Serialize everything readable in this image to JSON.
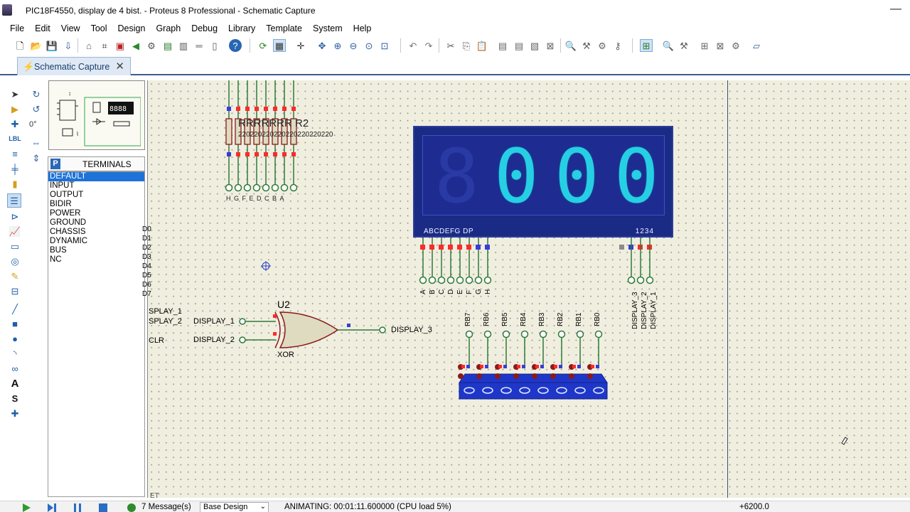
{
  "window": {
    "title": "PIC18F4550, display de 4 bist. - Proteus 8 Professional - Schematic Capture",
    "close_glyph": "—"
  },
  "menu": [
    "File",
    "Edit",
    "View",
    "Tool",
    "Design",
    "Graph",
    "Debug",
    "Library",
    "Template",
    "System",
    "Help"
  ],
  "doc_tab": {
    "label": "Schematic Capture",
    "close": "✕"
  },
  "rotation": "0°",
  "terminals": {
    "mode_badge": "P",
    "header": "TERMINALS",
    "items": [
      "DEFAULT",
      "INPUT",
      "OUTPUT",
      "BIDIR",
      "POWER",
      "GROUND",
      "CHASSIS",
      "DYNAMIC",
      "BUS",
      "NC"
    ],
    "selected": "DEFAULT"
  },
  "schematic": {
    "resistor_refs": "RRRRRRR R2",
    "resistor_values": "220220220220220220220220",
    "resistor_pin_labels": "HGFEDCBA",
    "port_labels": [
      "D0",
      "D1",
      "D2",
      "D3",
      "D4",
      "D5",
      "D6",
      "D7"
    ],
    "left_labels": [
      "SPLAY_1",
      "SPLAY_2",
      "CLR"
    ],
    "gate_ref": "U2",
    "gate_type": "XOR",
    "gate_inputs": [
      "DISPLAY_1",
      "DISPLAY_2"
    ],
    "gate_output": "DISPLAY_3",
    "lcd": {
      "digits": [
        "8",
        "0",
        "0",
        "0"
      ],
      "pin_label_left": "ABCDEFG DP",
      "pin_label_right": "1234"
    },
    "lcd_segment_pins": [
      "A",
      "B",
      "C",
      "D",
      "E",
      "F",
      "G",
      "H"
    ],
    "lcd_digit_pins": [
      "DISPLAY_3",
      "DISPLAY_2",
      "DISPLAY_1"
    ],
    "switch_labels": [
      "RB7",
      "RB6",
      "RB5",
      "RB4",
      "RB3",
      "RB2",
      "RB1",
      "RB0"
    ],
    "bottom_left_text": "ET"
  },
  "status": {
    "messages": "7 Message(s)",
    "design": "Base Design",
    "animation": "ANIMATING: 00:01:11.600000 (CPU load 5%)",
    "coord": "+6200.0"
  },
  "colors": {
    "lcd_digit": "#27cfe4",
    "lcd_bg": "#1a2b86",
    "wire": "#2d7a3a",
    "resistor": "#8b1a1a",
    "pin_high": "#ff2a2a",
    "pin_low": "#3b3bd8",
    "gate_fill": "#dedbc0"
  }
}
